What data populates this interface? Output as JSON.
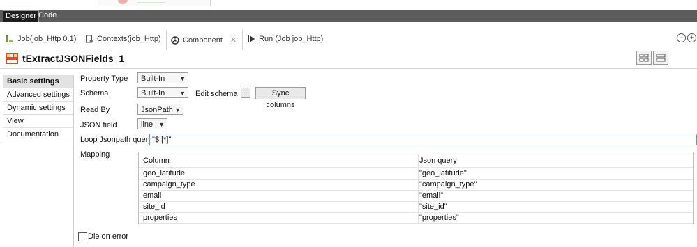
{
  "mode_tabs": {
    "designer": "Designer",
    "code": "Code"
  },
  "view_tabs": [
    {
      "label": "Job(job_Http 0.1)",
      "icon": "job-icon"
    },
    {
      "label": "Contexts(job_Http)",
      "icon": "contexts-icon"
    },
    {
      "label": "Component",
      "icon": "component-icon"
    },
    {
      "label": "Run (Job job_Http)",
      "icon": "run-icon"
    }
  ],
  "window_buttons": {
    "minimize": "−",
    "maximize": "+"
  },
  "component": {
    "title": "tExtractJSONFields_1",
    "logo_text": "JSON"
  },
  "nav": {
    "items": [
      "Basic settings",
      "Advanced settings",
      "Dynamic settings",
      "View",
      "Documentation"
    ]
  },
  "form": {
    "property_type_label": "Property Type",
    "property_type_value": "Built-In",
    "schema_label": "Schema",
    "schema_value": "Built-In",
    "edit_schema_label": "Edit schema",
    "ellipsis_label": "...",
    "sync_columns_label": "Sync columns",
    "read_by_label": "Read By",
    "read_by_value": "JsonPath",
    "json_field_label": "JSON field",
    "json_field_value": "line",
    "loop_query_label": "Loop Jsonpath query",
    "loop_query_value": "\"$.[*]\"",
    "mapping_label": "Mapping",
    "die_on_error_label": "Die on error"
  },
  "mapping": {
    "headers": [
      "Column",
      "Json query"
    ],
    "rows": [
      [
        "geo_latitude",
        "\"geo_latitude\""
      ],
      [
        "campaign_type",
        "\"campaign_type\""
      ],
      [
        "email",
        "\"email\""
      ],
      [
        "site_id",
        "\"site_id\""
      ],
      [
        "properties",
        "\"properties\""
      ]
    ]
  },
  "colors": {
    "mode_bar": "#5c5c5c",
    "input_focus": "#5a93d6",
    "nav_active": "#e2e2e2"
  }
}
